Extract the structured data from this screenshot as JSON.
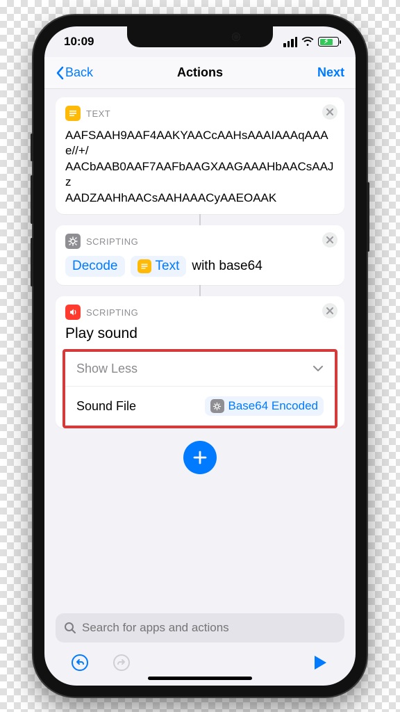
{
  "status": {
    "time": "10:09"
  },
  "nav": {
    "back": "Back",
    "title": "Actions",
    "next": "Next"
  },
  "text_action": {
    "category": "TEXT",
    "body": "AAFSAAH9AAF4AAKYAACcAAHsAAAIAAAqAAAe//+/\nAACbAAB0AAF7AAFbAAGXAAGAAAHbAACsAAJz\nAADZAAHhAACsAAHAAACyAAEOAAK"
  },
  "decode_action": {
    "category": "SCRIPTING",
    "verb": "Decode",
    "target": "Text",
    "suffix": "with base64"
  },
  "play_action": {
    "category": "SCRIPTING",
    "title": "Play sound",
    "show_less": "Show Less",
    "param_label": "Sound File",
    "param_value": "Base64 Encoded"
  },
  "search": {
    "placeholder": "Search for apps and actions"
  }
}
